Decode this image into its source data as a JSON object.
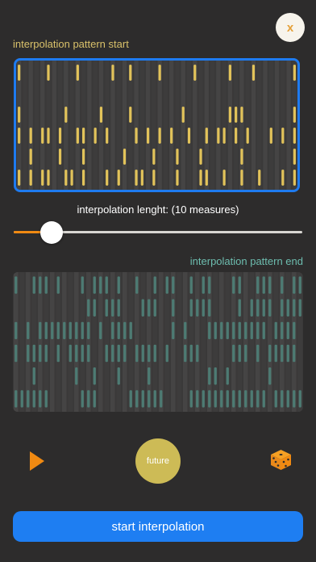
{
  "close_button": {
    "label": "x"
  },
  "pattern_start": {
    "label": "interpolation pattern start",
    "color": "#e2c35a",
    "rows": [
      [
        1,
        0,
        0,
        0,
        0,
        1,
        0,
        0,
        0,
        0,
        1,
        0,
        0,
        0,
        0,
        0,
        1,
        0,
        0,
        1,
        0,
        0,
        0,
        0,
        1,
        0,
        0,
        0,
        0,
        0,
        1,
        0,
        0,
        0,
        0,
        0,
        1,
        0,
        0,
        0,
        1,
        0,
        0,
        0,
        0,
        0,
        0,
        1
      ],
      [
        0,
        0,
        0,
        0,
        0,
        0,
        0,
        0,
        0,
        0,
        0,
        0,
        0,
        0,
        0,
        0,
        0,
        0,
        0,
        0,
        0,
        0,
        0,
        0,
        0,
        0,
        0,
        0,
        0,
        0,
        0,
        0,
        0,
        0,
        0,
        0,
        0,
        0,
        0,
        0,
        0,
        0,
        0,
        0,
        0,
        0,
        0,
        0
      ],
      [
        1,
        0,
        0,
        0,
        0,
        0,
        0,
        0,
        1,
        0,
        0,
        0,
        0,
        0,
        1,
        0,
        0,
        0,
        0,
        1,
        0,
        0,
        0,
        0,
        0,
        0,
        0,
        0,
        1,
        0,
        0,
        0,
        0,
        0,
        0,
        0,
        1,
        1,
        1,
        0,
        0,
        0,
        0,
        0,
        0,
        0,
        0,
        1
      ],
      [
        1,
        0,
        1,
        0,
        1,
        1,
        0,
        1,
        0,
        0,
        1,
        1,
        0,
        1,
        0,
        1,
        0,
        0,
        0,
        0,
        1,
        0,
        1,
        0,
        1,
        0,
        1,
        0,
        0,
        1,
        0,
        0,
        1,
        0,
        1,
        1,
        0,
        1,
        0,
        1,
        0,
        0,
        0,
        1,
        0,
        1,
        0,
        1
      ],
      [
        0,
        0,
        1,
        0,
        0,
        0,
        0,
        1,
        0,
        0,
        0,
        1,
        0,
        0,
        0,
        0,
        0,
        0,
        1,
        0,
        0,
        0,
        0,
        1,
        0,
        0,
        0,
        1,
        0,
        0,
        0,
        1,
        0,
        0,
        0,
        0,
        0,
        0,
        1,
        0,
        0,
        0,
        0,
        0,
        0,
        0,
        0,
        1
      ],
      [
        1,
        0,
        1,
        0,
        1,
        1,
        0,
        0,
        1,
        1,
        0,
        1,
        0,
        0,
        0,
        1,
        0,
        1,
        0,
        0,
        1,
        1,
        0,
        1,
        0,
        0,
        0,
        1,
        0,
        0,
        0,
        1,
        1,
        0,
        0,
        1,
        0,
        0,
        1,
        0,
        0,
        1,
        0,
        0,
        0,
        1,
        0,
        1
      ]
    ]
  },
  "slider": {
    "label": "interpolation lenght: (10 measures)",
    "value_fraction": 0.13,
    "fill_color": "#f08a12"
  },
  "pattern_end": {
    "label": "interpolation pattern end",
    "color": "#4d7b73",
    "rows": [
      [
        1,
        0,
        0,
        1,
        1,
        1,
        0,
        1,
        0,
        0,
        0,
        1,
        0,
        1,
        1,
        1,
        0,
        1,
        0,
        0,
        1,
        0,
        0,
        1,
        0,
        1,
        1,
        0,
        0,
        1,
        0,
        1,
        1,
        0,
        0,
        0,
        1,
        1,
        0,
        0,
        1,
        1,
        1,
        0,
        1,
        0,
        1,
        1
      ],
      [
        0,
        0,
        0,
        0,
        0,
        0,
        0,
        0,
        0,
        0,
        0,
        0,
        1,
        1,
        0,
        1,
        1,
        1,
        0,
        0,
        0,
        1,
        1,
        1,
        0,
        0,
        1,
        0,
        0,
        1,
        1,
        1,
        1,
        0,
        0,
        0,
        0,
        1,
        0,
        1,
        1,
        1,
        1,
        0,
        1,
        1,
        1,
        1
      ],
      [
        1,
        0,
        1,
        0,
        1,
        1,
        1,
        1,
        1,
        1,
        1,
        1,
        1,
        0,
        1,
        0,
        1,
        1,
        1,
        1,
        0,
        0,
        0,
        0,
        0,
        0,
        1,
        0,
        1,
        0,
        0,
        0,
        1,
        1,
        1,
        1,
        1,
        1,
        1,
        1,
        1,
        1,
        0,
        1,
        1,
        1,
        1,
        0
      ],
      [
        1,
        0,
        1,
        1,
        1,
        1,
        0,
        1,
        0,
        1,
        1,
        1,
        1,
        0,
        0,
        1,
        1,
        1,
        1,
        0,
        1,
        1,
        1,
        1,
        0,
        1,
        0,
        0,
        1,
        1,
        1,
        0,
        0,
        0,
        0,
        0,
        1,
        1,
        1,
        0,
        1,
        0,
        1,
        1,
        1,
        1,
        1,
        0
      ],
      [
        0,
        0,
        0,
        1,
        0,
        0,
        0,
        0,
        0,
        0,
        1,
        0,
        0,
        1,
        0,
        0,
        0,
        1,
        0,
        0,
        0,
        0,
        1,
        0,
        0,
        0,
        0,
        0,
        0,
        0,
        0,
        0,
        1,
        1,
        0,
        1,
        0,
        0,
        0,
        0,
        0,
        0,
        1,
        0,
        0,
        0,
        0,
        0
      ],
      [
        1,
        1,
        1,
        1,
        1,
        1,
        0,
        0,
        0,
        0,
        0,
        1,
        1,
        1,
        0,
        0,
        0,
        0,
        0,
        1,
        1,
        1,
        1,
        1,
        1,
        0,
        0,
        0,
        0,
        1,
        1,
        1,
        1,
        1,
        1,
        1,
        1,
        1,
        1,
        1,
        1,
        1,
        0,
        1,
        1,
        1,
        1,
        1
      ]
    ]
  },
  "controls": {
    "play_icon": "play-icon",
    "future_label": "future",
    "dice_icon": "dice-icon",
    "accent_color": "#f08a12"
  },
  "start_button": {
    "label": "start interpolation"
  }
}
